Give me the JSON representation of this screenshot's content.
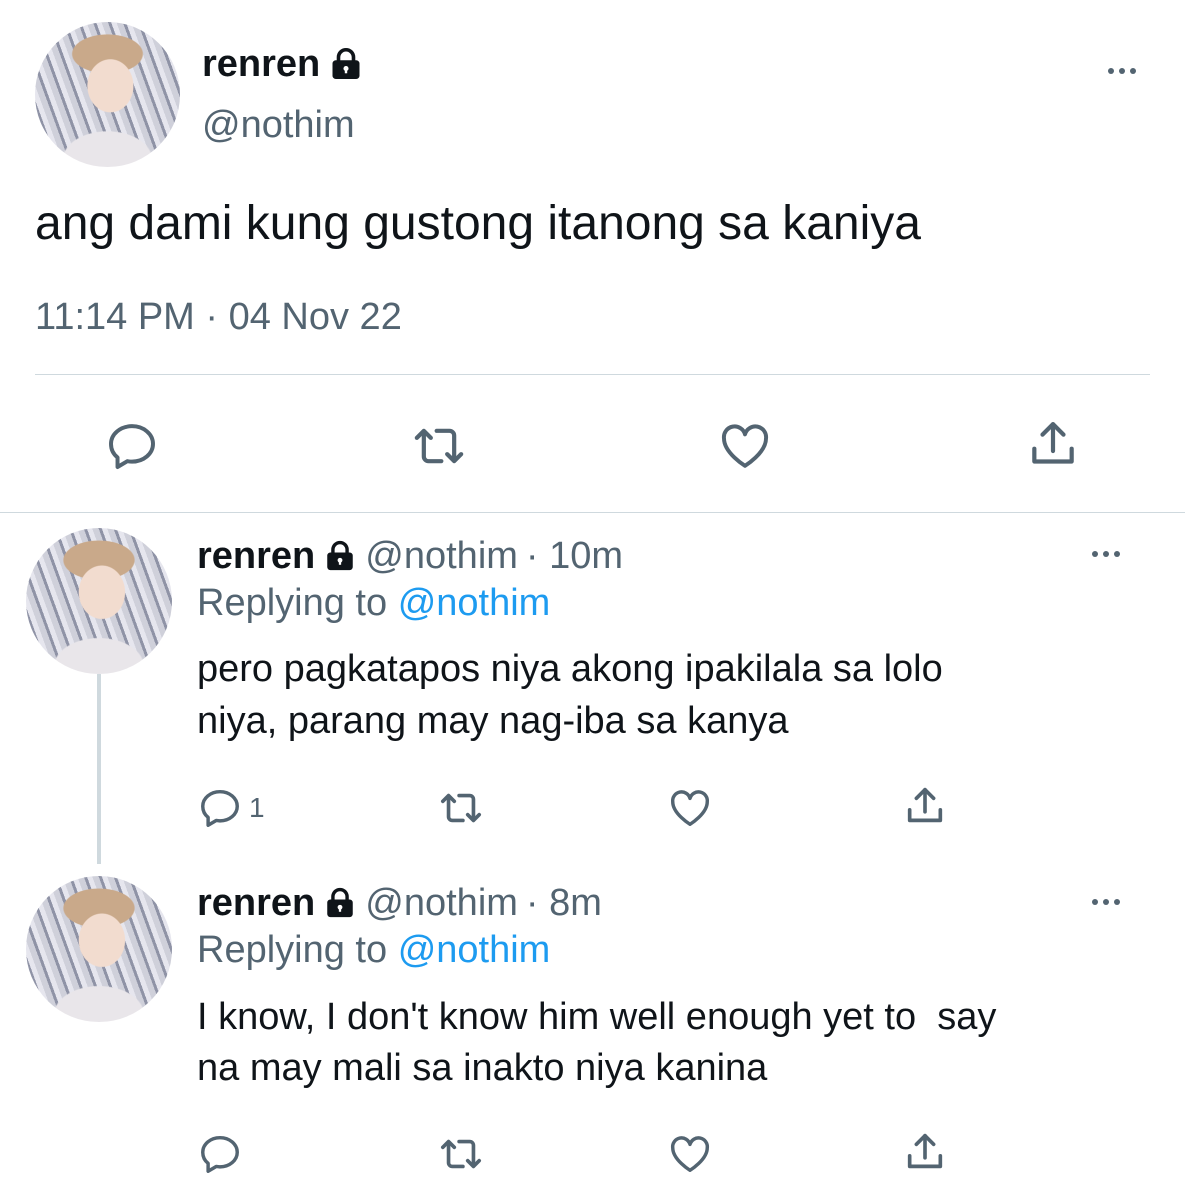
{
  "main_tweet": {
    "name": "renren",
    "handle": "@nothim",
    "text": "ang dami kung gustong itanong sa kaniya",
    "timestamp": "11:14 PM · 04 Nov 22"
  },
  "replies": [
    {
      "name": "renren",
      "handle": "@nothim",
      "time": "· 10m",
      "replying_label": "Replying to",
      "replying_handle": "@nothim",
      "text_line1": "pero pagkatapos niya akong ipakilala sa lolo",
      "text_line2": "niya, parang may nag-iba sa kanya",
      "reply_count": "1"
    },
    {
      "name": "renren",
      "handle": "@nothim",
      "time": "· 8m",
      "replying_label": "Replying to",
      "replying_handle": "@nothim",
      "text_line1": "I know, I don't know him well enough yet to  say",
      "text_line2": "na may mali sa inakto niya kanina",
      "reply_count": ""
    }
  ],
  "icons": [
    "lock-icon",
    "more-icon",
    "reply-icon",
    "retweet-icon",
    "like-icon",
    "share-icon"
  ],
  "colors": {
    "text": "#0f1419",
    "muted": "#536471",
    "link": "#1d9bf0",
    "divider": "#cfd9de"
  }
}
